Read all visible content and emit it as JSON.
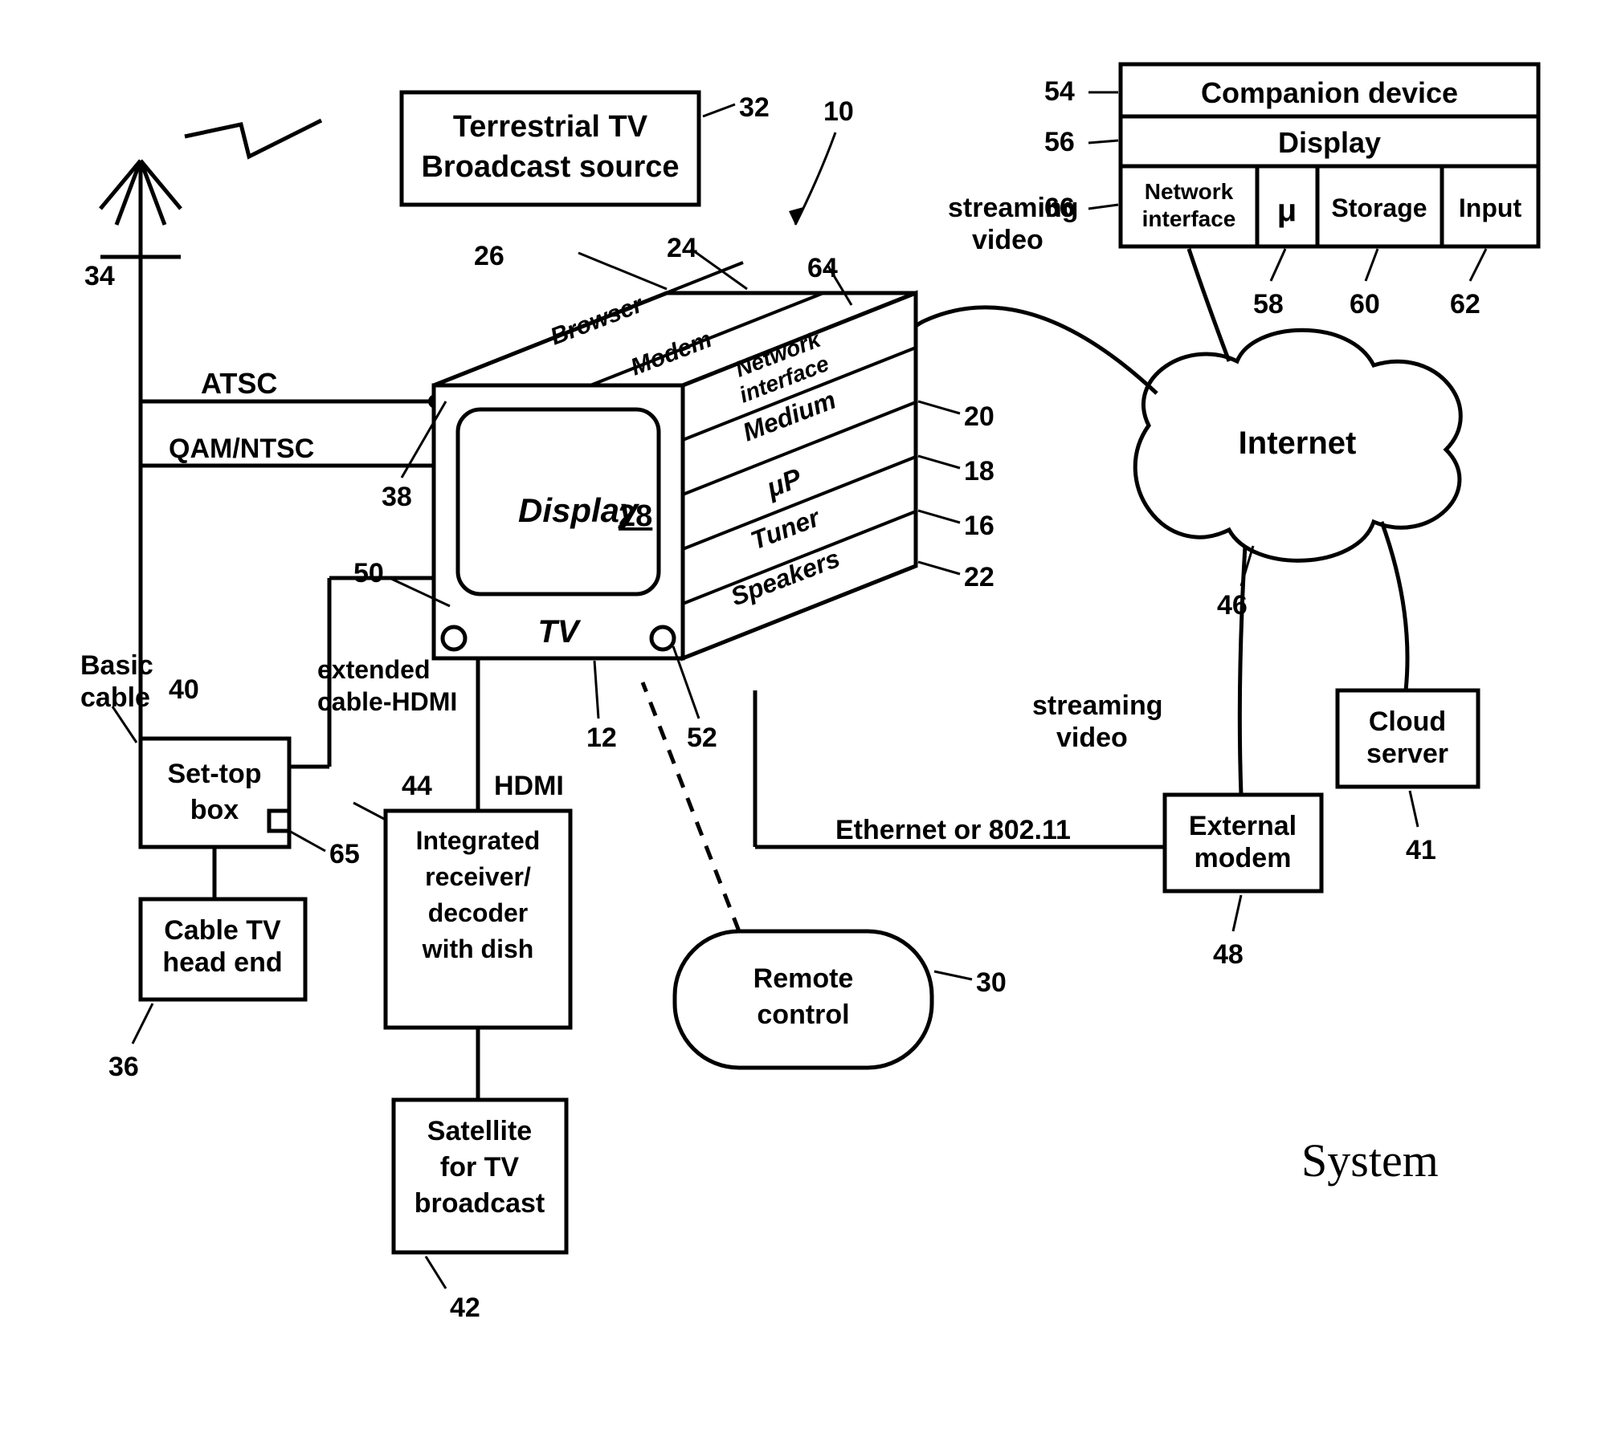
{
  "title": "System",
  "blocks": {
    "terrestrial": "Terrestrial TV\nBroadcast source",
    "settop": "Set-top\nbox",
    "cable_head": "Cable TV\nhead end",
    "ird": "Integrated\nreceiver/\ndecoder\nwith dish",
    "satellite": "Satellite\nfor TV\nbroadcast",
    "remote": "Remote\ncontrol",
    "ext_modem": "External\nmodem",
    "cloud_server": "Cloud\nserver",
    "internet": "Internet",
    "companion": "Companion device",
    "comp_display": "Display",
    "comp_net": "Network\ninterface",
    "comp_mu": "μ",
    "comp_storage": "Storage",
    "comp_input": "Input"
  },
  "tv": {
    "display_label": "Display",
    "display_num": "28",
    "tv_label": "TV",
    "browser": "Browser",
    "modem": "Modem",
    "netif": "Network\ninterface",
    "medium": "Medium",
    "up": "μP",
    "tuner": "Tuner",
    "speakers": "Speakers"
  },
  "edge_labels": {
    "atsc": "ATSC",
    "qam": "QAM/NTSC",
    "basic_cable": "Basic\ncable",
    "ext_cable": "extended\ncable-HDMI",
    "hdmi": "HDMI",
    "ethernet": "Ethernet or 802.11",
    "stream1": "streaming\nvideo",
    "stream2": "streaming\nvideo"
  },
  "refs": {
    "n10": "10",
    "n12": "12",
    "n16": "16",
    "n18": "18",
    "n20": "20",
    "n22": "22",
    "n24": "24",
    "n26": "26",
    "n28": "28",
    "n30": "30",
    "n32": "32",
    "n34": "34",
    "n36": "36",
    "n38": "38",
    "n40": "40",
    "n41": "41",
    "n42": "42",
    "n44": "44",
    "n46": "46",
    "n48": "48",
    "n50": "50",
    "n52": "52",
    "n54": "54",
    "n56": "56",
    "n58": "58",
    "n60": "60",
    "n62": "62",
    "n64": "64",
    "n65": "65",
    "n66": "66"
  }
}
